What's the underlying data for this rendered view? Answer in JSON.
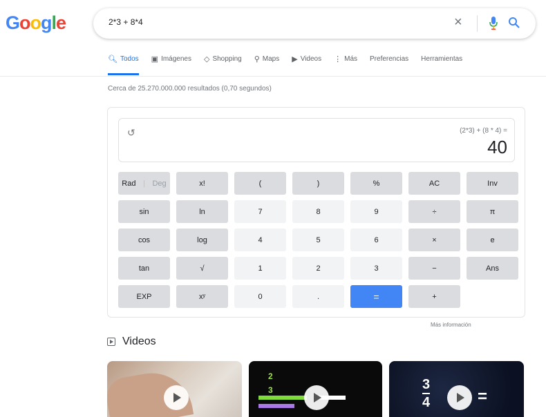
{
  "search": {
    "query": "2*3 + 8*4"
  },
  "tabs": [
    {
      "icon": "search-icon",
      "label": "Todos"
    },
    {
      "icon": "image-icon",
      "label": "Imágenes"
    },
    {
      "icon": "tag-icon",
      "label": "Shopping"
    },
    {
      "icon": "map-pin-icon",
      "label": "Maps"
    },
    {
      "icon": "video-icon",
      "label": "Videos"
    },
    {
      "icon": "more-icon",
      "label": "Más"
    },
    {
      "icon": "",
      "label": "Preferencias"
    },
    {
      "icon": "",
      "label": "Herramientas"
    }
  ],
  "result_stats": "Cerca de 25.270.000.000 resultados (0,70 segundos)",
  "calculator": {
    "expression": "(2*3) + (8 * 4) =",
    "result": "40",
    "keys": [
      "Rad",
      "Deg",
      "x!",
      "(",
      ")",
      "%",
      "AC",
      "Inv",
      "sin",
      "ln",
      "7",
      "8",
      "9",
      "÷",
      "π",
      "cos",
      "log",
      "4",
      "5",
      "6",
      "×",
      "e",
      "tan",
      "√",
      "1",
      "2",
      "3",
      "−",
      "Ans",
      "EXP",
      "xʸ",
      "0",
      ".",
      "=",
      "+"
    ],
    "more_info": "Más información"
  },
  "videos": {
    "heading": "Videos",
    "thumb2_fraction": {
      "num": "2",
      "den": "3"
    },
    "thumb3_fraction": {
      "num": "3",
      "den": "4"
    }
  },
  "colors": {
    "accent": "#1a73e8",
    "equals": "#4285f4"
  }
}
